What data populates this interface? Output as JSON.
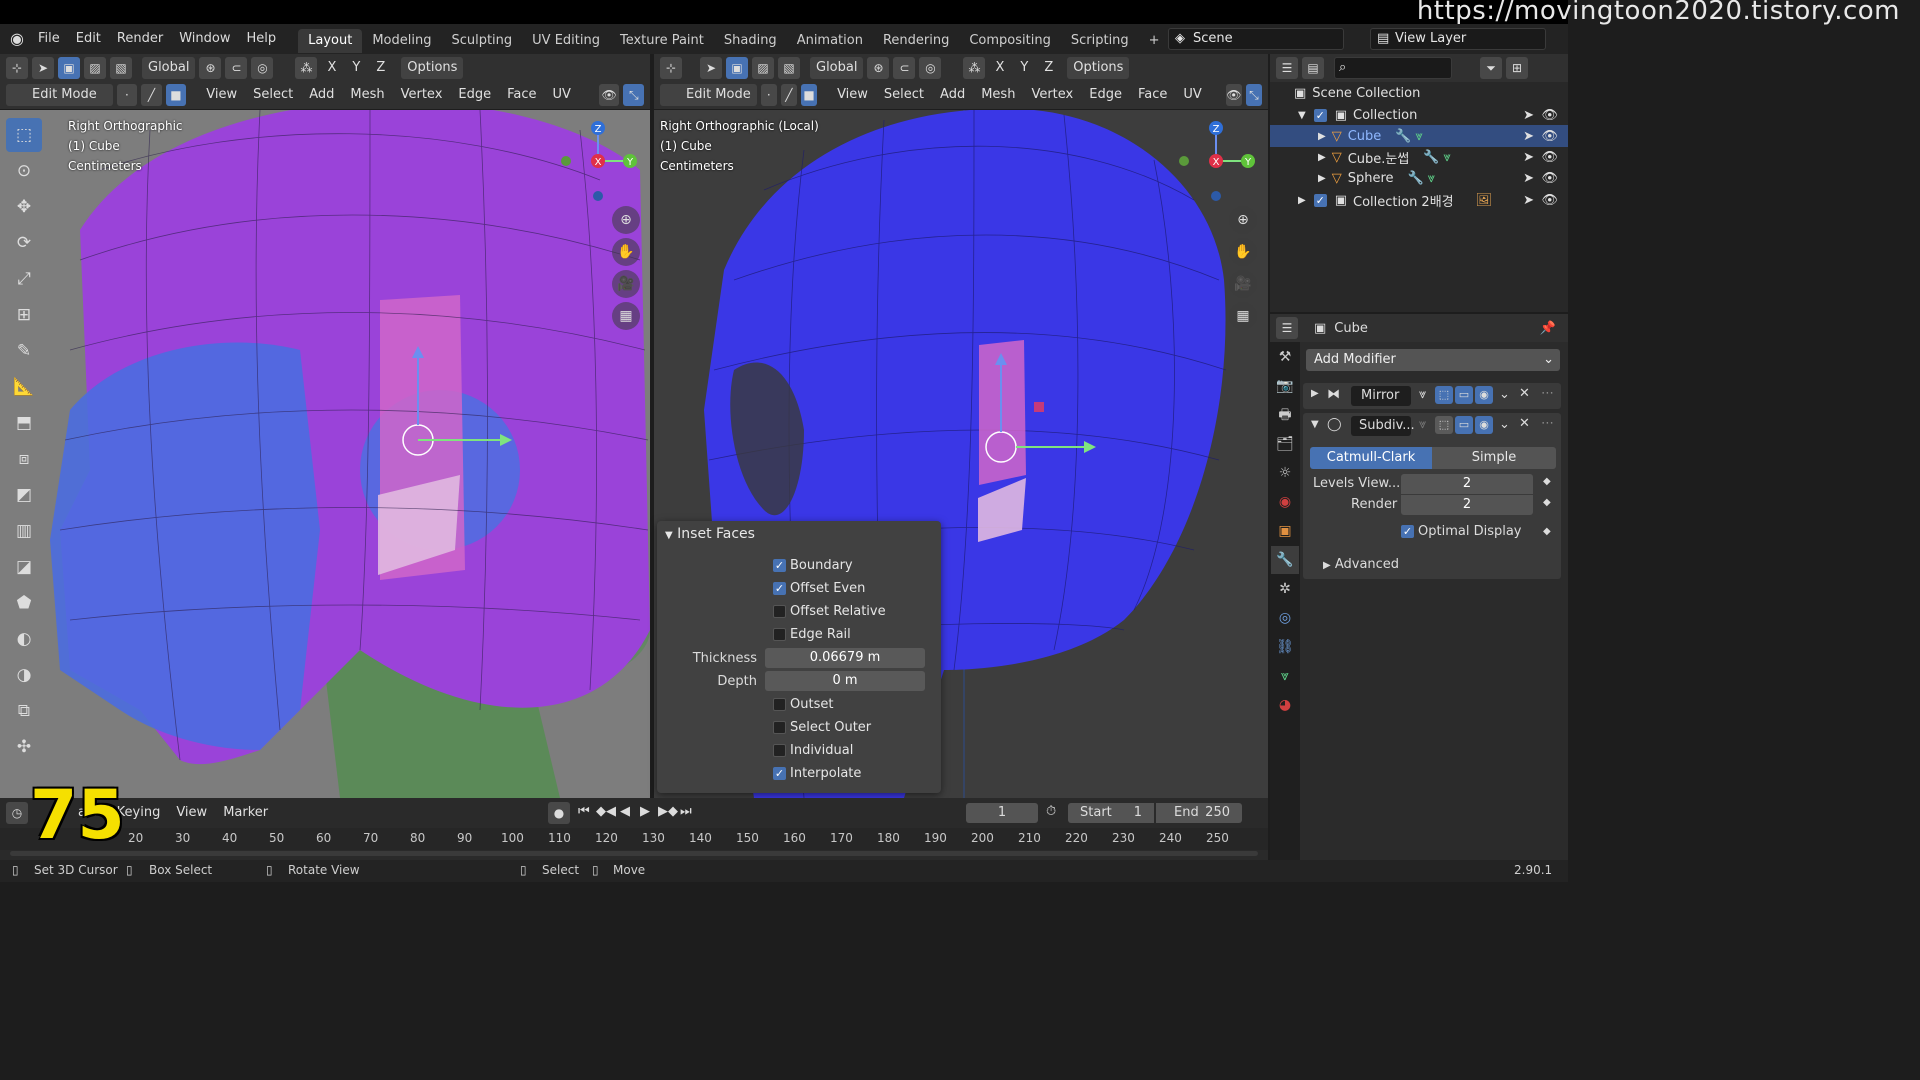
{
  "watermark": "https://movingtoon2020.tistory.com",
  "menu": [
    "File",
    "Edit",
    "Render",
    "Window",
    "Help"
  ],
  "workspace_tabs": [
    {
      "label": "Layout",
      "active": true
    },
    {
      "label": "Modeling",
      "active": false
    },
    {
      "label": "Sculpting",
      "active": false
    },
    {
      "label": "UV Editing",
      "active": false
    },
    {
      "label": "Texture Paint",
      "active": false
    },
    {
      "label": "Shading",
      "active": false
    },
    {
      "label": "Animation",
      "active": false
    },
    {
      "label": "Rendering",
      "active": false
    },
    {
      "label": "Compositing",
      "active": false
    },
    {
      "label": "Scripting",
      "active": false
    }
  ],
  "add_workspace": "+",
  "scene": {
    "name": "Scene"
  },
  "view_layer": {
    "name": "View Layer"
  },
  "left_view": {
    "orientation": "Global",
    "axes": [
      "X",
      "Y",
      "Z"
    ],
    "options": "Options",
    "mode": "Edit Mode",
    "menus": [
      "View",
      "Select",
      "Add",
      "Mesh",
      "Vertex",
      "Edge",
      "Face",
      "UV"
    ],
    "info": [
      "Right Orthographic",
      "(1) Cube",
      "Centimeters"
    ]
  },
  "right_view": {
    "orientation": "Global",
    "axes": [
      "X",
      "Y",
      "Z"
    ],
    "options": "Options",
    "mode": "Edit Mode",
    "menus": [
      "View",
      "Select",
      "Add",
      "Mesh",
      "Vertex",
      "Edge",
      "Face",
      "UV"
    ],
    "info": [
      "Right Orthographic (Local)",
      "(1) Cube",
      "Centimeters"
    ]
  },
  "gizmo": {
    "x": "X",
    "y": "Y",
    "z": "Z"
  },
  "inset_panel": {
    "title": "Inset Faces",
    "boundary": {
      "label": "Boundary",
      "checked": true
    },
    "offset_even": {
      "label": "Offset Even",
      "checked": true
    },
    "offset_relative": {
      "label": "Offset Relative",
      "checked": false
    },
    "edge_rail": {
      "label": "Edge Rail",
      "checked": false
    },
    "thickness": {
      "label": "Thickness",
      "value": "0.06679 m"
    },
    "depth": {
      "label": "Depth",
      "value": "0 m"
    },
    "outset": {
      "label": "Outset",
      "checked": false
    },
    "select_outer": {
      "label": "Select Outer",
      "checked": false
    },
    "individual": {
      "label": "Individual",
      "checked": false
    },
    "interpolate": {
      "label": "Interpolate",
      "checked": true
    }
  },
  "outliner": {
    "root": "Scene Collection",
    "items": [
      {
        "label": "Collection"
      },
      {
        "label": "Cube"
      },
      {
        "label": "Cube.눈썹"
      },
      {
        "label": "Sphere"
      },
      {
        "label": "Collection 2배경"
      }
    ]
  },
  "properties": {
    "object": "Cube",
    "add_modifier": "Add Modifier",
    "mirror": "Mirror",
    "subdiv": "Subdiv...",
    "catmull": "Catmull-Clark",
    "simple": "Simple",
    "levels_label": "Levels View...",
    "levels_value": "2",
    "render_label": "Render",
    "render_value": "2",
    "optimal": "Optimal Display",
    "advanced": "Advanced"
  },
  "timeline": {
    "playback": "ack",
    "keying": "Keying",
    "view": "View",
    "marker": "Marker",
    "current_frame": "1",
    "start_label": "Start",
    "start": "1",
    "end_label": "End",
    "end": "250",
    "ticks": [
      "20",
      "30",
      "40",
      "50",
      "60",
      "70",
      "80",
      "90",
      "100",
      "110",
      "120",
      "130",
      "140",
      "150",
      "160",
      "170",
      "180",
      "190",
      "200",
      "210",
      "220",
      "230",
      "240",
      "250"
    ]
  },
  "status": {
    "set_cursor": "Set 3D Cursor",
    "box_select": "Box Select",
    "rotate_view": "Rotate View",
    "select": "Select",
    "move": "Move",
    "version": "2.90.1"
  },
  "frame_overlay": "75",
  "colors": {
    "accent": "#4772b3",
    "purple": "#8a2fd6",
    "blue_mesh": "#3a37e6",
    "header": "#303030",
    "panel": "#414141"
  }
}
